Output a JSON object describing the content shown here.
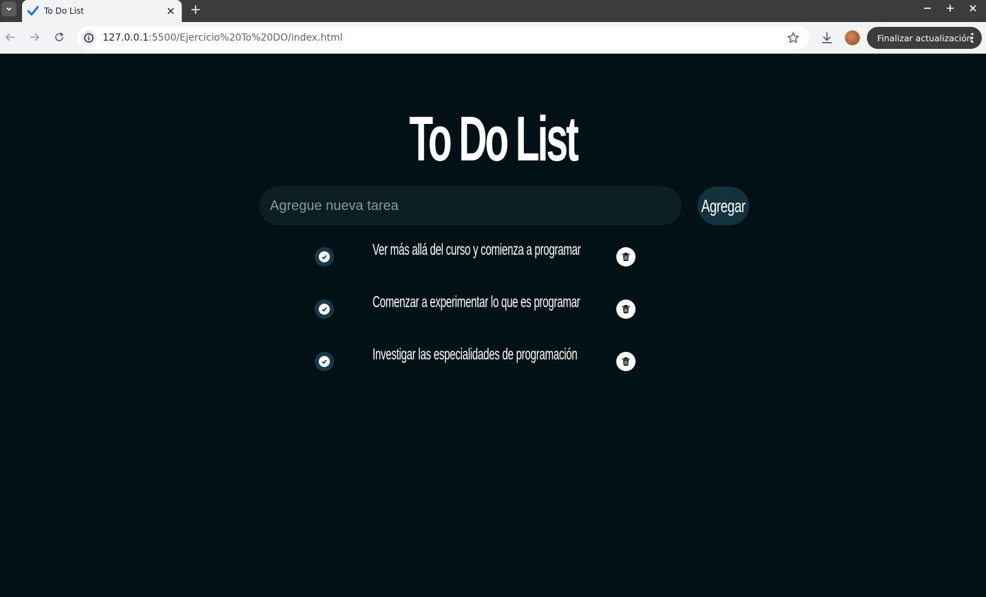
{
  "browser": {
    "tab": {
      "title": "To Do List"
    },
    "url": {
      "host": "127.0.0.1",
      "path": ":5500/Ejercicio%20To%20DO/index.html"
    },
    "update_button": "Finalizar actualización",
    "icons": [
      "tab-search-icon",
      "todo-favicon-icon",
      "close-icon",
      "plus-icon",
      "minimize-icon",
      "maximize-icon",
      "back-icon",
      "forward-icon",
      "reload-icon",
      "site-info-icon",
      "star-icon",
      "download-icon",
      "avatar",
      "more-icon"
    ]
  },
  "app": {
    "title": "To Do List",
    "input": {
      "placeholder": "Agregue nueva tarea",
      "value": ""
    },
    "add_button": "Agregar",
    "tasks": [
      {
        "text": "Ver más allá del curso y comienza a programar"
      },
      {
        "text": "Comenzar a experimentar lo que es programar"
      },
      {
        "text": "Investigar las especialidades de programación"
      }
    ],
    "colors": {
      "background": "#011115",
      "input_bg": "#0a1e23",
      "button_bg": "#12323d",
      "check_bg": "#163a4a",
      "text": "#ffffff"
    }
  }
}
